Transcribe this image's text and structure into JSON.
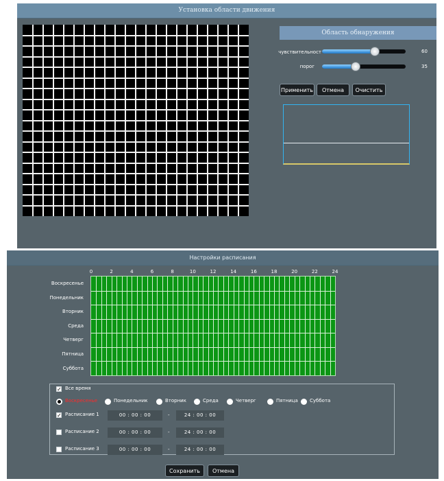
{
  "motion": {
    "title": "Установка области движения",
    "detect_header": "Область обнаружения",
    "sensitivity": {
      "label": "чувствительност",
      "value": 60,
      "display": "60"
    },
    "threshold": {
      "label": "порог",
      "value": 35,
      "display": "35"
    },
    "buttons": {
      "apply": "Применить",
      "cancel": "Отмена",
      "clear": "Очистить"
    }
  },
  "schedule": {
    "title": "Настройки расписания",
    "days": [
      "Воскресенье",
      "Понедельник",
      "Вторник",
      "Среда",
      "Четверг",
      "Пятница",
      "Суббота"
    ],
    "hour_ticks": [
      "0",
      "2",
      "4",
      "6",
      "8",
      "10",
      "12",
      "14",
      "16",
      "18",
      "20",
      "22",
      "24"
    ],
    "all_time": {
      "label": "Все время",
      "checked": true
    },
    "day_radios": [
      {
        "label": "Воскресенье",
        "selected": true
      },
      {
        "label": "Понедельник",
        "selected": false
      },
      {
        "label": "Вторник",
        "selected": false
      },
      {
        "label": "Среда",
        "selected": false
      },
      {
        "label": "Четверг",
        "selected": false
      },
      {
        "label": "Пятница",
        "selected": false
      },
      {
        "label": "Суббота",
        "selected": false
      }
    ],
    "rows": [
      {
        "label": "Расписание 1",
        "checked": true,
        "start": "00  :  00  :  00",
        "sep": "-",
        "end": "24  :  00  :  00"
      },
      {
        "label": "Расписание 2",
        "checked": false,
        "start": "00  :  00  :  00",
        "sep": "-",
        "end": "24  :  00  :  00"
      },
      {
        "label": "Расписание 3",
        "checked": false,
        "start": "00  :  00  :  00",
        "sep": "-",
        "end": "24  :  00  :  00"
      }
    ],
    "buttons": {
      "save": "Сохранить",
      "cancel": "Отмена"
    }
  },
  "colors": {
    "panel": "#56636a",
    "schedule_fill": "#0b9614",
    "accent_blue": "#32b4f2",
    "selected_day_text": "#ff2a2a"
  }
}
